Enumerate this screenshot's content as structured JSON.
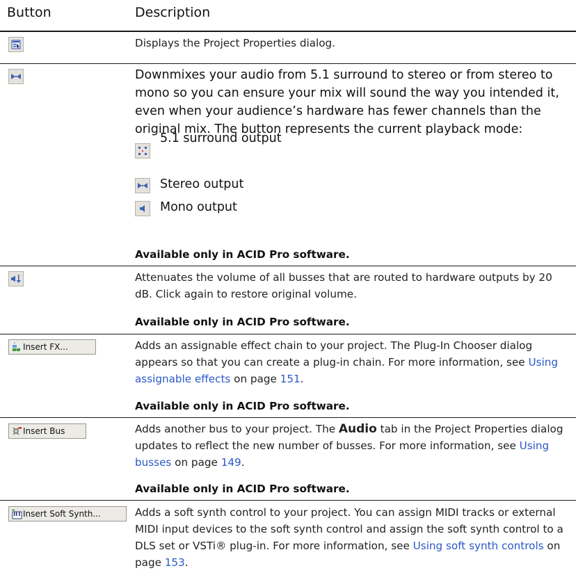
{
  "header": {
    "col_button": "Button",
    "col_description": "Description"
  },
  "rows": {
    "properties": {
      "icon": "project-properties-icon",
      "description": "Displays the Project Properties dialog."
    },
    "downmix": {
      "icon": "downmix-stereo-icon",
      "description": "Downmixes your audio from 5.1 surround to stereo or from stereo to mono so you can ensure your mix will sound the way you intended it, even when your audience’s hardware has fewer channels than the original mix. The button represents the current playback mode:",
      "modes": [
        {
          "icon": "surround-output-icon",
          "label": "5.1 surround output"
        },
        {
          "icon": "stereo-output-icon",
          "label": "Stereo output"
        },
        {
          "icon": "mono-output-icon",
          "label": "Mono output"
        }
      ],
      "availability": "Available only in ACID Pro software."
    },
    "dim": {
      "icon": "dim-output-icon",
      "description": "Attenuates the volume of all busses that are routed to hardware outputs by 20 dB. Click again to restore original volume.",
      "availability": "Available only in ACID Pro software."
    },
    "insert_fx": {
      "button_label": "Insert FX...",
      "icon": "insert-fx-icon",
      "desc_before": "Adds an assignable effect chain to your project. The Plug-In Chooser dialog appears so that you can create a plug-in chain. For more information, see ",
      "link_text": "Using assignable effects",
      "desc_mid": " on page ",
      "page_ref": "151",
      "desc_end": ".",
      "availability": "Available only in ACID Pro software."
    },
    "insert_bus": {
      "button_label": "Insert Bus",
      "icon": "insert-bus-icon",
      "desc_before": "Adds another bus to your project. The ",
      "desc_strong": "Audio",
      "desc_after_strong": " tab in the Project Properties dialog updates to reflect the new number of busses. For more information, see ",
      "link_text": "Using busses",
      "desc_mid": " on page ",
      "page_ref": "149",
      "desc_end": ".",
      "availability": "Available only in ACID Pro software."
    },
    "insert_soft_synth": {
      "button_label": "Insert Soft Synth...",
      "icon": "insert-soft-synth-icon",
      "desc_before": "Adds a soft synth control to your project. You can assign MIDI tracks or external MIDI input devices to the soft synth control and assign the soft synth control to a DLS set or VSTi® plug-in. For more information, see ",
      "link_text": "Using soft synth controls",
      "desc_mid": " on page ",
      "page_ref": "153",
      "desc_end": "."
    }
  }
}
